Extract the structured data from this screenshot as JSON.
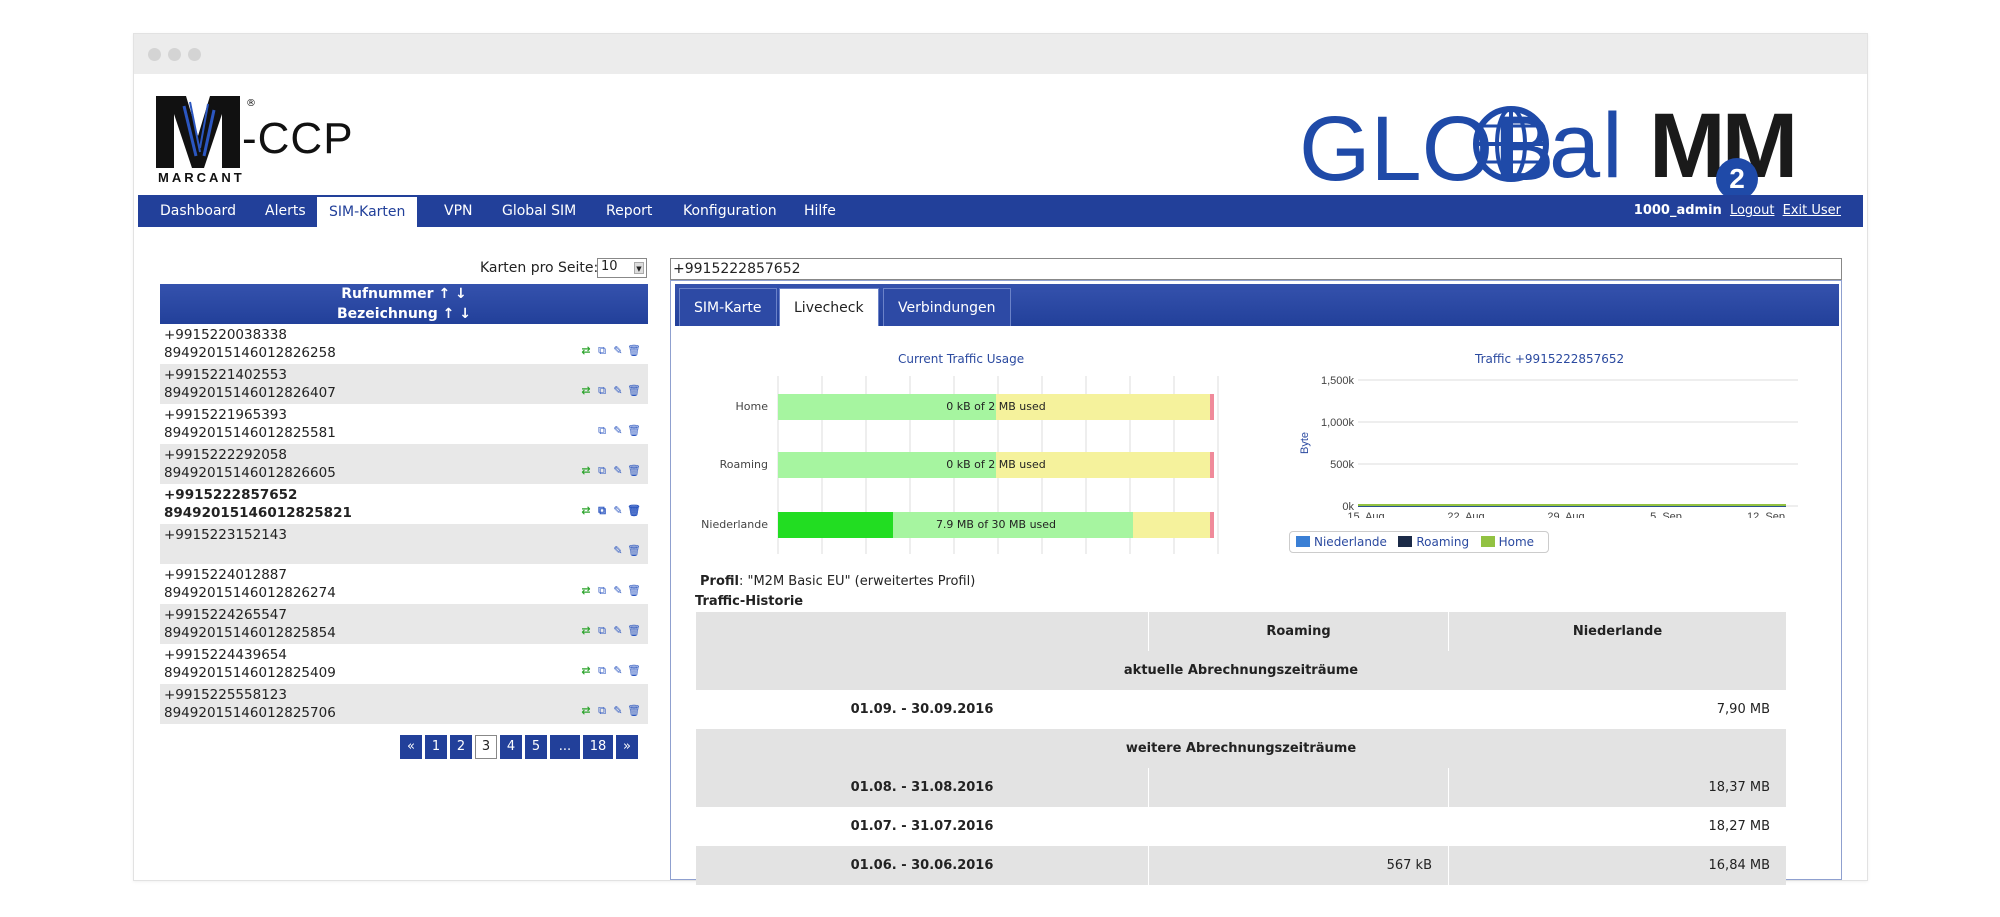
{
  "header": {
    "logo_left": {
      "mark": "M",
      "product": "-CCP",
      "registered": "®",
      "company": "MARCANT"
    },
    "logo_right": {
      "global": "GLOB",
      "al": "al",
      "m2m": "MM",
      "m2m_badge": "2"
    }
  },
  "nav": {
    "items": [
      "Dashboard",
      "Alerts",
      "SIM-Karten",
      "VPN",
      "Global SIM",
      "Report",
      "Konfiguration",
      "Hilfe"
    ],
    "active": "SIM-Karten",
    "user": "1000_admin",
    "logout": "Logout",
    "exit_user": "Exit User"
  },
  "sim_list": {
    "per_page_label": "Karten pro Seite:",
    "per_page_value": "10",
    "header_rufnummer": "Rufnummer ↑ ↓",
    "header_bezeichnung": "Bezeichnung ↑ ↓",
    "rows": [
      {
        "number": "+9915220038338",
        "iccid": "8949201514601282625​8",
        "actions": [
          "switch",
          "link",
          "edit",
          "delete"
        ]
      },
      {
        "number": "+9915221402553",
        "iccid": "89492015146012826407",
        "actions": [
          "switch",
          "link",
          "edit",
          "delete"
        ]
      },
      {
        "number": "+9915221965393",
        "iccid": "89492015146012825581",
        "actions": [
          "link",
          "edit",
          "delete"
        ]
      },
      {
        "number": "+9915222292058",
        "iccid": "89492015146012826605",
        "actions": [
          "switch",
          "link",
          "edit",
          "delete"
        ]
      },
      {
        "number": "+9915222857652",
        "iccid": "89492015146012825821",
        "actions": [
          "switch",
          "link",
          "edit",
          "delete"
        ]
      },
      {
        "number": "+9915223152143",
        "iccid": "",
        "actions": [
          "edit",
          "delete"
        ]
      },
      {
        "number": "+9915224012887",
        "iccid": "89492015146012826274",
        "actions": [
          "switch",
          "link",
          "edit",
          "delete"
        ]
      },
      {
        "number": "+9915224265547",
        "iccid": "89492015146012825854",
        "actions": [
          "switch",
          "link",
          "edit",
          "delete"
        ]
      },
      {
        "number": "+9915224439654",
        "iccid": "89492015146012825409",
        "actions": [
          "switch",
          "link",
          "edit",
          "delete"
        ]
      },
      {
        "number": "+9915225558123",
        "iccid": "89492015146012825706",
        "actions": [
          "switch",
          "link",
          "edit",
          "delete"
        ]
      }
    ],
    "pager": [
      "«",
      "1",
      "2",
      "3",
      "4",
      "5",
      "...",
      "18",
      "»"
    ],
    "pager_current": "3"
  },
  "detail": {
    "search_value": "+9915222857652",
    "tabs": [
      "SIM-Karte",
      "Livecheck",
      "Verbindungen"
    ],
    "active_tab": "Livecheck",
    "profil_label": "Profil",
    "profil_value": ": \"M2M Basic EU\" (erweitertes Profil)",
    "historie_label": "Traffic-Historie",
    "history": {
      "columns": [
        "",
        "Roaming",
        "Niederlande"
      ],
      "section_current": "aktuelle Abrechnungszeiträume",
      "section_more": "weitere Abrechnungszeiträume",
      "current_rows": [
        {
          "period": "01.09. - 30.09.2016",
          "roaming": "",
          "niederlande": "7,90 MB"
        }
      ],
      "more_rows": [
        {
          "period": "01.08. - 31.08.2016",
          "roaming": "",
          "niederlande": "18,37 MB"
        },
        {
          "period": "01.07. - 31.07.2016",
          "roaming": "",
          "niederlande": "18,27 MB"
        },
        {
          "period": "01.06. - 30.06.2016",
          "roaming": "567 kB",
          "niederlande": "16,84 MB"
        }
      ]
    }
  },
  "chart_data": [
    {
      "type": "bar",
      "title": "Current Traffic Usage",
      "categories": [
        "Home",
        "Roaming",
        "Niederlande"
      ],
      "used_fraction": [
        0.0,
        0.0,
        0.264
      ],
      "labels": [
        "0 kB of 2 MB used",
        "0 kB of 2 MB used",
        "7.9 MB of 30 MB used"
      ],
      "colors": {
        "used": "#22dd22",
        "ok": "#a6f5a0",
        "warn": "#f5f29c",
        "limit": "#f08a9a"
      }
    },
    {
      "type": "line",
      "title": "Traffic +9915222857652",
      "ylabel": "Byte",
      "yticks": [
        "0k",
        "500k",
        "1,000k",
        "1,500k"
      ],
      "ylim": [
        0,
        1500
      ],
      "xticks": [
        "15. Aug",
        "22. Aug",
        "29. Aug",
        "5. Sep",
        "12. Sep"
      ],
      "series": [
        {
          "name": "Niederlande",
          "color": "#3a7fd5",
          "values": [
            0,
            0,
            0,
            0,
            0
          ]
        },
        {
          "name": "Roaming",
          "color": "#1b2a47",
          "values": [
            0,
            0,
            0,
            0,
            0
          ]
        },
        {
          "name": "Home",
          "color": "#92c242",
          "values": [
            0,
            0,
            0,
            0,
            0
          ]
        }
      ]
    }
  ]
}
